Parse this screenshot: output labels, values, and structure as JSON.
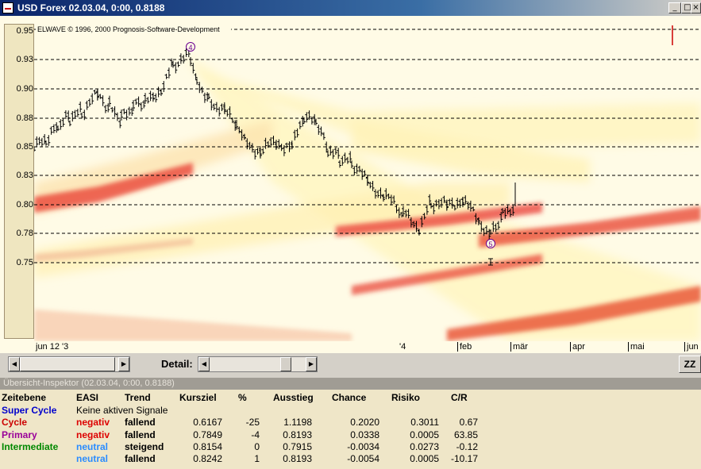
{
  "window": {
    "title": "USD Forex  02.03.04, 0:00, 0.8188",
    "buttons": [
      "_",
      "□",
      "×"
    ]
  },
  "chart": {
    "copyright": "ELWAVE © 1996, 2000 Prognosis-Software-Development",
    "y_ticks": [
      "0.95",
      "0.93",
      "0.90",
      "0.88",
      "0.85",
      "0.83",
      "0.80",
      "0.78",
      "0.75"
    ],
    "x_ticks": [
      "jun 12 '3",
      "'4",
      "feb",
      "mär",
      "apr",
      "mai",
      "jun"
    ],
    "wave_labels": [
      "4",
      "5"
    ],
    "colors": {
      "heat": "#e8302a",
      "bands": "#fff0a0",
      "background": "#fffbe6"
    }
  },
  "controls": {
    "detail_label": "Detail:",
    "zz_label": "ZZ"
  },
  "inspector": {
    "title": "Übersicht-Inspektor (02.03.04, 0:00, 0.8188)",
    "headers": [
      "Zeitebene",
      "EASI",
      "Trend",
      "Kursziel",
      "%",
      "Ausstieg",
      "Chance",
      "Risiko",
      "C/R"
    ],
    "rows": [
      {
        "level": "Super Cycle",
        "level_color": "#0000cc",
        "easi": "Keine aktiven Signale",
        "easi_color": "#000000",
        "trend": "",
        "kursziel": "",
        "pct": "",
        "ausstieg": "",
        "chance": "",
        "risiko": "",
        "cr": ""
      },
      {
        "level": "Cycle",
        "level_color": "#cc0000",
        "easi": "negativ",
        "easi_color": "#dd0000",
        "trend": "fallend",
        "kursziel": "0.6167",
        "pct": "-25",
        "ausstieg": "1.1198",
        "chance": "0.2020",
        "risiko": "0.3011",
        "cr": "0.67"
      },
      {
        "level": "Primary",
        "level_color": "#990099",
        "easi": "negativ",
        "easi_color": "#dd0000",
        "trend": "fallend",
        "kursziel": "0.7849",
        "pct": "-4",
        "ausstieg": "0.8193",
        "chance": "0.0338",
        "risiko": "0.0005",
        "cr": "63.85"
      },
      {
        "level": "Intermediate",
        "level_color": "#008800",
        "easi": "neutral",
        "easi_color": "#2a8cff",
        "trend": "steigend",
        "kursziel": "0.8154",
        "pct": "0",
        "ausstieg": "0.7915",
        "chance": "-0.0034",
        "risiko": "0.0273",
        "cr": "-0.12"
      },
      {
        "level": "",
        "level_color": "#000000",
        "easi": "neutral",
        "easi_color": "#2a8cff",
        "trend": "fallend",
        "kursziel": "0.8242",
        "pct": "1",
        "ausstieg": "0.8193",
        "chance": "-0.0054",
        "risiko": "0.0005",
        "cr": "-10.17"
      }
    ]
  }
}
